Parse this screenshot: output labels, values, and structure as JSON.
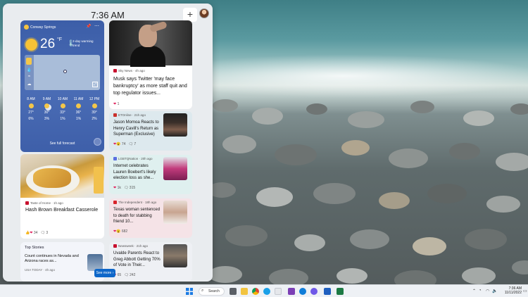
{
  "panel": {
    "time": "7:36 AM",
    "add_label": "+"
  },
  "weather": {
    "location": "Conway Springs",
    "temperature": "26",
    "unit": "°F",
    "trend": "2-day warming trend",
    "forecast": [
      {
        "hour": "8 AM",
        "icon": "sun-icon",
        "temp": "27°",
        "precip": "6%"
      },
      {
        "hour": "9 AM",
        "icon": "cloud-sun-icon",
        "temp": "30°",
        "precip": "3%"
      },
      {
        "hour": "10 AM",
        "icon": "sun-icon",
        "temp": "33°",
        "precip": "1%"
      },
      {
        "hour": "11 AM",
        "icon": "sun-icon",
        "temp": "36°",
        "precip": "1%"
      },
      {
        "hour": "12 PM",
        "icon": "sun-icon",
        "temp": "39°",
        "precip": "2%"
      }
    ],
    "link": "See full forecast"
  },
  "hero": {
    "source": "Sky News · 4h ago",
    "title": "Musk says Twitter 'may face bankruptcy' as more staff quit and top regulator issues...",
    "reactions": "1"
  },
  "news": [
    {
      "source": "ETOnline · 21h ago",
      "title": "Jason Momoa Reacts to Henry Cavill's Return as Superman (Exclusive)",
      "reactions": "74",
      "comments": "7",
      "logo_color": "#c9302c"
    },
    {
      "source": "LGBTQNation · 20h ago",
      "title": "Internet celebrates Lauren Boebert's likely election loss as she...",
      "reactions": "1k",
      "comments": "315",
      "logo_color": "#5b6ee1"
    },
    {
      "source": "The Independent · 18h ago",
      "title": "Texas woman sentenced to death for stabbing friend 10...",
      "reactions": "682",
      "comments": "",
      "logo_color": "#d8232a"
    },
    {
      "source": "Newsweek · 21h ago",
      "title": "Uvalde Parents React to Greg Abbott Getting 70% of Vote in Their...",
      "reactions": "65",
      "comments": "242",
      "logo_color": "#c8102e"
    }
  ],
  "recipe": {
    "source": "Taste of Home · 1h ago",
    "title": "Hash Brown Breakfast Casserole",
    "reactions": "34",
    "comments": "3"
  },
  "stories": {
    "heading": "Top Stories",
    "item": "Count continues in Nevada and Arizona races as...",
    "source": "USA TODAY · 4h ago",
    "see_more": "See more"
  },
  "taskbar": {
    "search_label": "Search",
    "time": "7:36 AM",
    "date": "11/11/2022",
    "apps": [
      "file-explorer-icon",
      "chrome-icon",
      "edge-icon",
      "onenote-icon",
      "messenger-icon",
      "word-icon",
      "excel-icon",
      "teams-icon"
    ]
  },
  "colors": {
    "weather_bg": "#4466b0",
    "see_more_bg": "#0e67c9",
    "accent": "#1b7be3"
  }
}
